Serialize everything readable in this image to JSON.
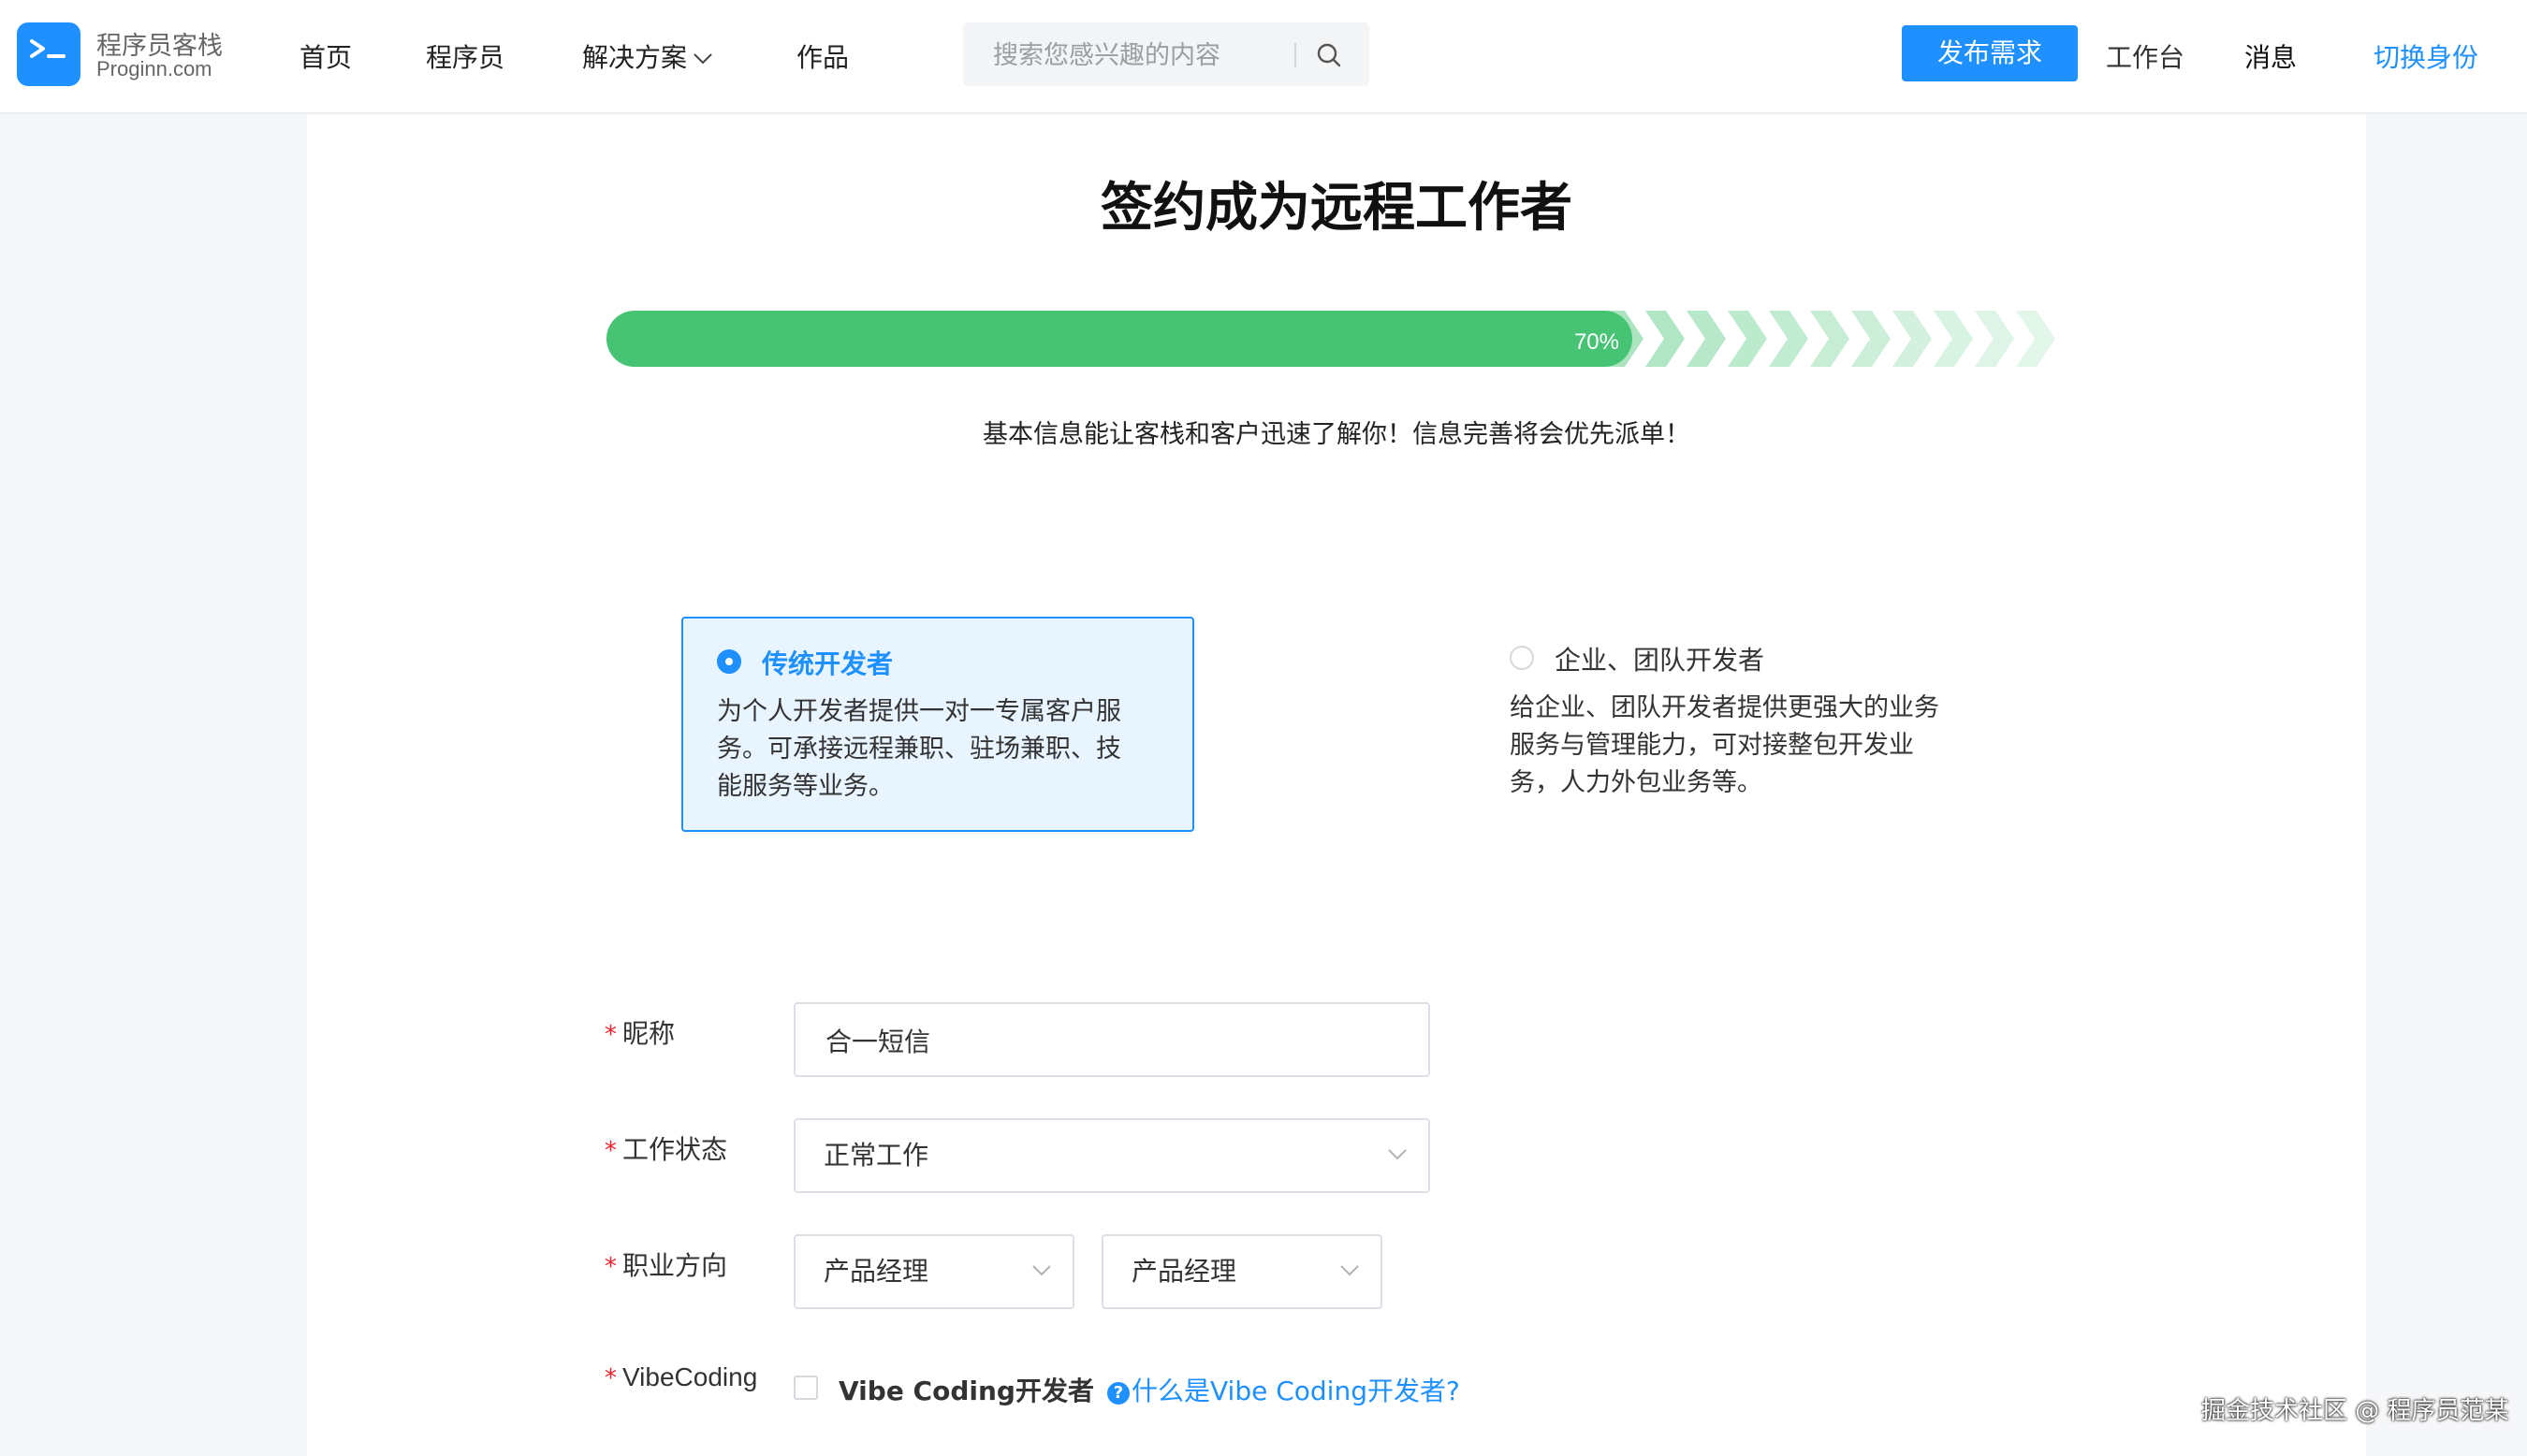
{
  "header": {
    "logo_cn": "程序员客栈",
    "logo_en": "Proginn.com",
    "nav": {
      "home": "首页",
      "programmers": "程序员",
      "solutions": "解决方案",
      "works": "作品"
    },
    "search_placeholder": "搜索您感兴趣的内容",
    "publish": "发布需求",
    "workbench": "工作台",
    "messages": "消息",
    "switch_identity": "切换身份",
    "accent_color": "#1e90ff"
  },
  "page": {
    "title": "签约成为远程工作者",
    "progress": {
      "value": 0.7,
      "label": "70%",
      "color": "#46c474"
    },
    "subtitle": "基本信息能让客栈和客户迅速了解你！信息完善将会优先派单！"
  },
  "roles": [
    {
      "title": "传统开发者",
      "desc": [
        "为个人开发者提供一对一专属客户服",
        "务。可承接远程兼职、驻场兼职、技",
        "能服务等业务。"
      ],
      "selected": true
    },
    {
      "title": "企业、团队开发者",
      "desc": [
        "给企业、团队开发者提供更强大的业务",
        "服务与管理能力，可对接整包开发业",
        "务，人力外包业务等。"
      ],
      "selected": false
    }
  ],
  "form": {
    "required_mark": "*",
    "nickname": {
      "label": "昵称",
      "value": "合一短信"
    },
    "work_status": {
      "label": "工作状态",
      "value": "正常工作"
    },
    "career": {
      "label": "职业方向",
      "value1": "产品经理",
      "value2": "产品经理"
    },
    "vibe": {
      "label": "VibeCoding",
      "checkbox_label": "Vibe Coding开发者",
      "help_icon": "?",
      "help_text": "什么是Vibe Coding开发者?",
      "checked": false
    }
  },
  "watermark": "掘金技术社区 @ 程序员范某"
}
